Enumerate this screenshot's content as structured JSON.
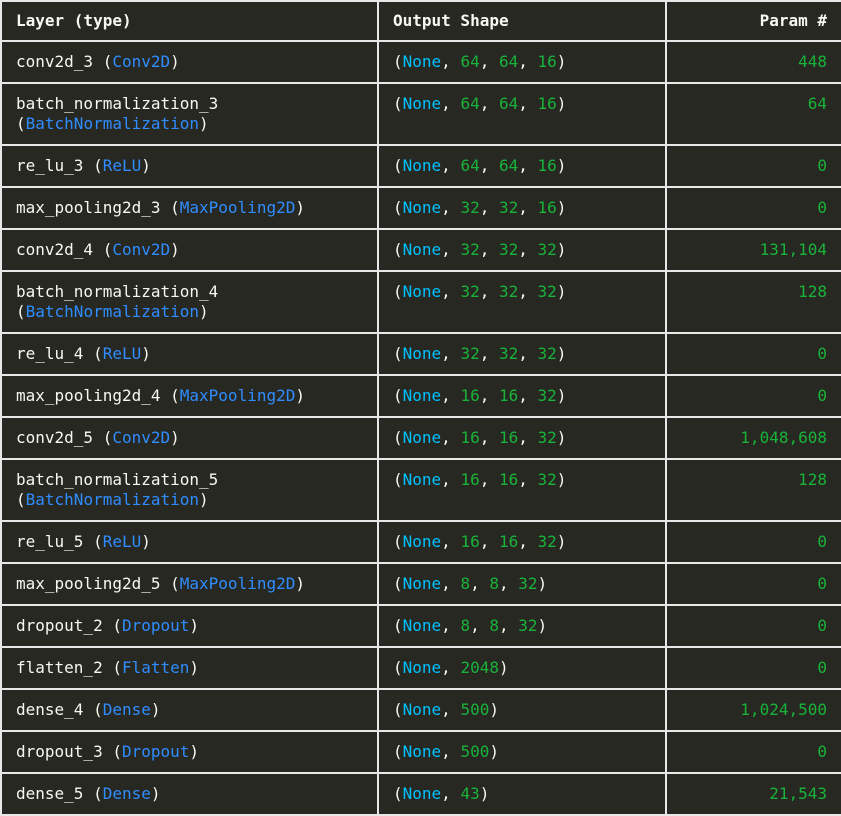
{
  "header": {
    "layer": "Layer (type)",
    "output": "Output Shape",
    "params": "Param #"
  },
  "colors": {
    "background": "#272822",
    "text": "#f8f8f2",
    "type": "#2f8dff",
    "none": "#00c1ff",
    "number": "#19b33a",
    "border": "#e8e8e8"
  },
  "rows": [
    {
      "name": "conv2d_3",
      "type": "Conv2D",
      "wrap": false,
      "shape": [
        "None",
        "64",
        "64",
        "16"
      ],
      "params": "448"
    },
    {
      "name": "batch_normalization_3",
      "type": "BatchNormalization",
      "wrap": true,
      "shape": [
        "None",
        "64",
        "64",
        "16"
      ],
      "params": "64"
    },
    {
      "name": "re_lu_3",
      "type": "ReLU",
      "wrap": false,
      "shape": [
        "None",
        "64",
        "64",
        "16"
      ],
      "params": "0"
    },
    {
      "name": "max_pooling2d_3",
      "type": "MaxPooling2D",
      "wrap": false,
      "shape": [
        "None",
        "32",
        "32",
        "16"
      ],
      "params": "0"
    },
    {
      "name": "conv2d_4",
      "type": "Conv2D",
      "wrap": false,
      "shape": [
        "None",
        "32",
        "32",
        "32"
      ],
      "params": "131,104"
    },
    {
      "name": "batch_normalization_4",
      "type": "BatchNormalization",
      "wrap": true,
      "shape": [
        "None",
        "32",
        "32",
        "32"
      ],
      "params": "128"
    },
    {
      "name": "re_lu_4",
      "type": "ReLU",
      "wrap": false,
      "shape": [
        "None",
        "32",
        "32",
        "32"
      ],
      "params": "0"
    },
    {
      "name": "max_pooling2d_4",
      "type": "MaxPooling2D",
      "wrap": false,
      "shape": [
        "None",
        "16",
        "16",
        "32"
      ],
      "params": "0"
    },
    {
      "name": "conv2d_5",
      "type": "Conv2D",
      "wrap": false,
      "shape": [
        "None",
        "16",
        "16",
        "32"
      ],
      "params": "1,048,608"
    },
    {
      "name": "batch_normalization_5",
      "type": "BatchNormalization",
      "wrap": true,
      "shape": [
        "None",
        "16",
        "16",
        "32"
      ],
      "params": "128"
    },
    {
      "name": "re_lu_5",
      "type": "ReLU",
      "wrap": false,
      "shape": [
        "None",
        "16",
        "16",
        "32"
      ],
      "params": "0"
    },
    {
      "name": "max_pooling2d_5",
      "type": "MaxPooling2D",
      "wrap": false,
      "shape": [
        "None",
        "8",
        "8",
        "32"
      ],
      "params": "0"
    },
    {
      "name": "dropout_2",
      "type": "Dropout",
      "wrap": false,
      "shape": [
        "None",
        "8",
        "8",
        "32"
      ],
      "params": "0"
    },
    {
      "name": "flatten_2",
      "type": "Flatten",
      "wrap": false,
      "shape": [
        "None",
        "2048"
      ],
      "params": "0"
    },
    {
      "name": "dense_4",
      "type": "Dense",
      "wrap": false,
      "shape": [
        "None",
        "500"
      ],
      "params": "1,024,500"
    },
    {
      "name": "dropout_3",
      "type": "Dropout",
      "wrap": false,
      "shape": [
        "None",
        "500"
      ],
      "params": "0"
    },
    {
      "name": "dense_5",
      "type": "Dense",
      "wrap": false,
      "shape": [
        "None",
        "43"
      ],
      "params": "21,543"
    }
  ]
}
